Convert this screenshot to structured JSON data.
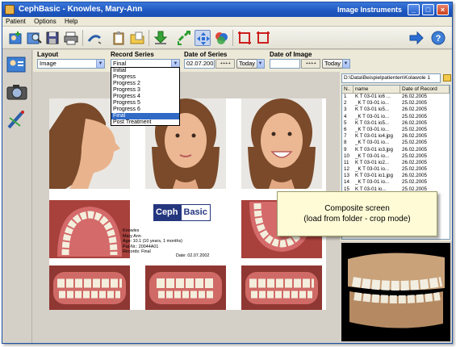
{
  "window": {
    "title": "CephBasic - Knowles, Mary-Ann",
    "right_title": "Image Instruments",
    "minimize": "_",
    "maximize": "□",
    "close": "×"
  },
  "menu": [
    "Patient",
    "Options",
    "Help"
  ],
  "filters": {
    "layout_label": "Layout",
    "layout_value": "Image",
    "series_label": "Record Series",
    "series_value": "Final",
    "date_series_label": "Date of Series",
    "date_series_value": "02.07.2002",
    "date_image_label": "Date of Image",
    "date_image_value": "",
    "today": "Today",
    "spinner": "+ + + +"
  },
  "dropdown": {
    "options": [
      "Initial",
      "Progress",
      "Progress 2",
      "Progress 3",
      "Progress 4",
      "Progress 5",
      "Progress 6",
      "Final",
      "Post Treatment"
    ],
    "selected_index": 7
  },
  "composite": {
    "logo_a": "Ceph",
    "logo_b": "Basic",
    "info_lines": [
      "Knowles",
      "Mary Ann",
      "Age: 10.1 (10 years, 1 months)",
      "Pat-Nr.: 20044A01",
      "Records: Final"
    ],
    "date": "Date: 02.07.2002"
  },
  "files": {
    "path": "D:\\Data\\Beispielpatienten\\Kolawole 1",
    "headers": [
      "N..",
      "name",
      "Date of Record"
    ],
    "rows": [
      [
        "1",
        "K T 03-01 io6 ...",
        "26.02.2005"
      ],
      [
        "2",
        "_K T 03-01 io...",
        "25.02.2005"
      ],
      [
        "3",
        "K T 03-01 io5...",
        "26.02.2005"
      ],
      [
        "4",
        "_K T 03-01 io...",
        "25.02.2005"
      ],
      [
        "5",
        "K T 03-01 io5...",
        "26.02.2005"
      ],
      [
        "6",
        "_K T 03-01 io...",
        "25.02.2005"
      ],
      [
        "7",
        "K T 03-01 io4.jpg",
        "26.02.2005"
      ],
      [
        "8",
        "_K T 03-01 io...",
        "25.02.2005"
      ],
      [
        "9",
        "K T 03-01 io3.jpg",
        "26.02.2005"
      ],
      [
        "10",
        "_K T 03-01 io...",
        "25.02.2005"
      ],
      [
        "11",
        "K T 03-01 io2...",
        "26.02.2005"
      ],
      [
        "12",
        "_K T 03-01 io...",
        "25.02.2005"
      ],
      [
        "13",
        "K T 03-01 io1.jpg",
        "26.02.2005"
      ],
      [
        "14",
        "_K T 03-01 io...",
        "25.02.2005"
      ],
      [
        "15",
        "K T 03-01 io...",
        "25.02.2005"
      ]
    ]
  },
  "callout": {
    "line1": "Composite screen",
    "line2": "(load from folder - crop mode)"
  },
  "colors": {
    "titlebar": "#1f57c0",
    "selection": "#316ac5",
    "logo": "#24367e",
    "callout": "#fffbd7"
  },
  "icons": [
    "app-icon",
    "new-patient-icon",
    "search-patient-icon",
    "save-icon",
    "print-icon",
    "draw-icon",
    "clipboard-icon",
    "folder-open-icon",
    "download-icon",
    "swap-icon",
    "move-icon",
    "color-icon",
    "crop-icon",
    "crop-alt-icon",
    "arrow-right-icon",
    "help-icon",
    "patient-card-icon",
    "camera-icon",
    "measure-icon"
  ]
}
